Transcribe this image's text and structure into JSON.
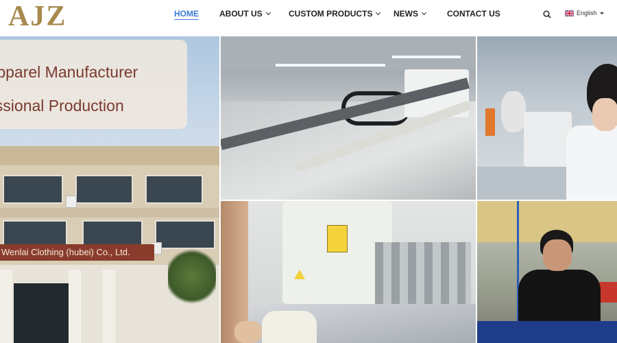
{
  "header": {
    "logo": "AJZ",
    "nav": [
      {
        "label": "HOME",
        "active": true,
        "dropdown": false
      },
      {
        "label": "ABOUT US",
        "active": false,
        "dropdown": true
      },
      {
        "label": "CUSTOM PRODUCTS",
        "active": false,
        "dropdown": true
      },
      {
        "label": "NEWS",
        "active": false,
        "dropdown": true
      },
      {
        "label": "CONTACT US",
        "active": false,
        "dropdown": false
      }
    ],
    "language": "English",
    "icons": {
      "search": "search-icon",
      "flag": "uk-flag-icon"
    },
    "colors": {
      "logo": "#a88a4e",
      "active_nav": "#3a7bd5",
      "nav_text": "#222222"
    }
  },
  "hero": {
    "banner_line1": "Apparel Manufacturer",
    "banner_line2": "essional Production",
    "building_sign": "Wenlai Clothing (hubei) Co., Ltd.",
    "colors": {
      "banner_text": "#7a3a2e",
      "sign_bg": "#8a3c2c"
    }
  }
}
